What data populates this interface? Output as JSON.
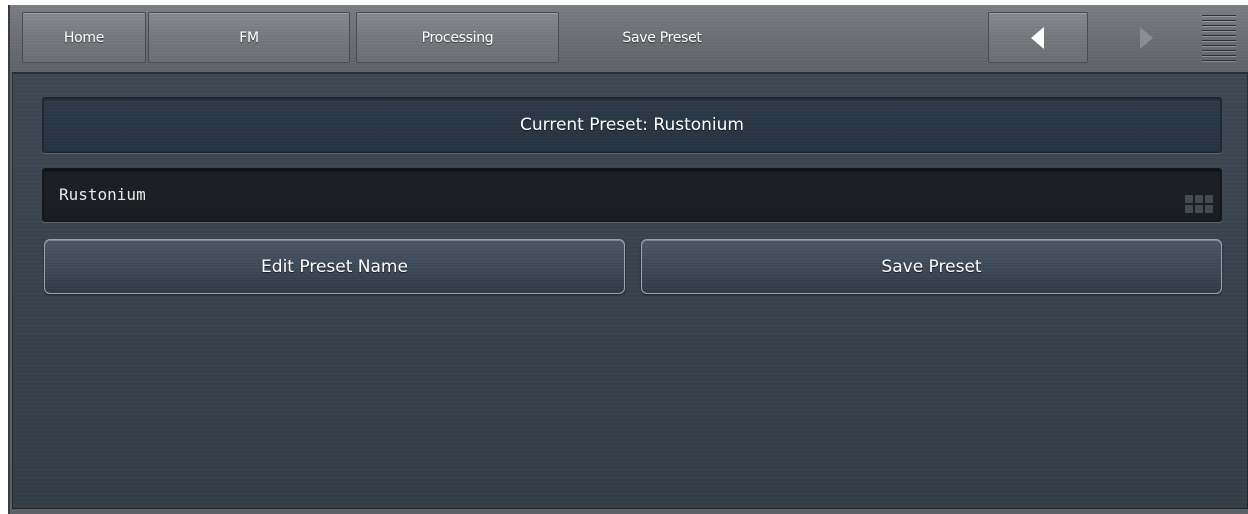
{
  "nav": {
    "tabs": [
      {
        "label": "Home"
      },
      {
        "label": "FM"
      },
      {
        "label": "Processing"
      },
      {
        "label": "Save Preset"
      }
    ],
    "prev_icon": "triangle-left-icon",
    "next_icon": "triangle-right-icon",
    "menu_icon": "hamburger-menu-icon"
  },
  "main": {
    "current_preset": "Current Preset: Rustonium",
    "name_field": {
      "value": "Rustonium",
      "keyboard_icon": "keyboard-icon"
    },
    "buttons": {
      "edit_label": "Edit Preset Name",
      "save_label": "Save Preset"
    }
  },
  "colors": {
    "panel_bg": "#3a434e",
    "navbar_bg": "#74777c",
    "text": "#ffffff",
    "field_bg": "#1b1f24"
  }
}
